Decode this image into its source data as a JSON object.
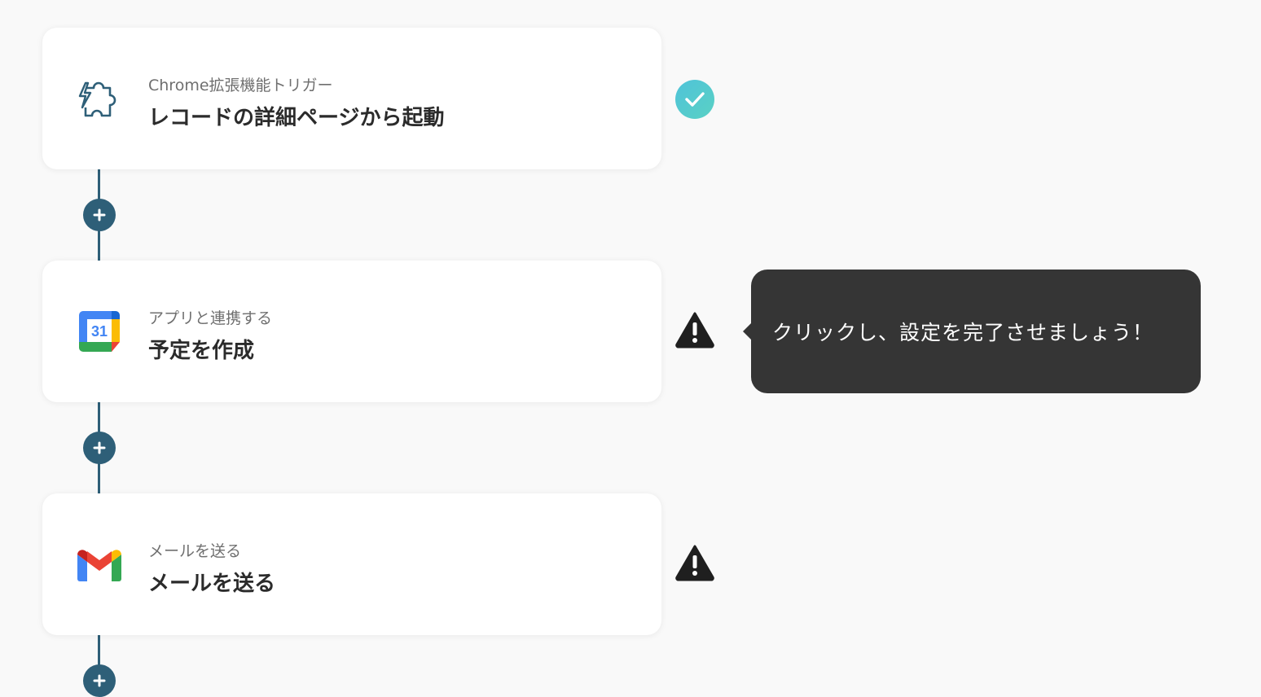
{
  "steps": [
    {
      "id": "trigger",
      "subtitle": "Chrome拡張機能トリガー",
      "title": "レコードの詳細ページから起動",
      "icon": "puzzle-lightning-icon",
      "status": "complete"
    },
    {
      "id": "calendar",
      "subtitle": "アプリと連携する",
      "title": "予定を作成",
      "icon": "google-calendar-icon",
      "icon_text": "31",
      "status": "warning"
    },
    {
      "id": "gmail",
      "subtitle": "メールを送る",
      "title": "メールを送る",
      "icon": "gmail-icon",
      "status": "warning"
    }
  ],
  "tooltip": {
    "text": "クリックし、設定を完了させましょう！"
  },
  "colors": {
    "connector": "#2e5f78",
    "check_gradient_start": "#4fc3d9",
    "check_gradient_end": "#5ad1c4",
    "warning": "#1f1f1f",
    "tooltip_bg": "#353535"
  }
}
